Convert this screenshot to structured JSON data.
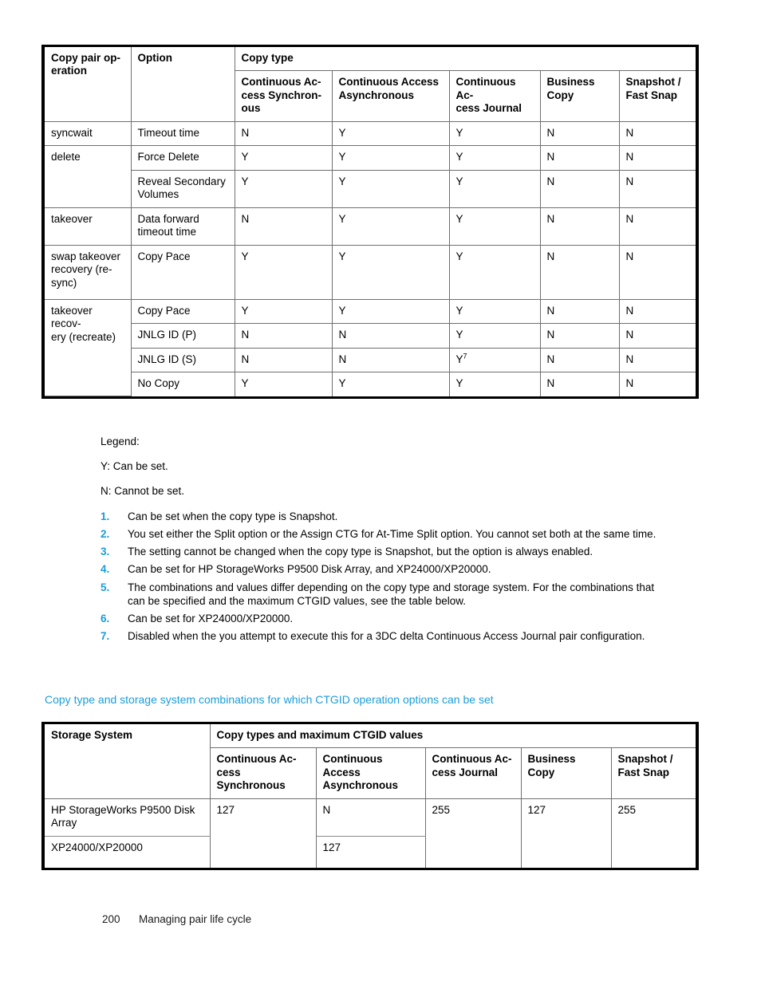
{
  "table1": {
    "group_header": "Copy type",
    "columns": [
      "Copy pair operation",
      "Option",
      "Continuous Access Synchronous",
      "Continuous Access Asynchronous",
      "Continuous Access Journal",
      "Business Copy",
      "Snapshot / Fast Snap"
    ],
    "col_display": {
      "c1": "Copy pair op-\neration",
      "c2": "Option",
      "c3": "Continuous Ac-\ncess Synchron-\nous",
      "c4": "Continuous Access\nAsynchronous",
      "c5": "Continuous Ac-\ncess Journal",
      "c6": "Business\nCopy",
      "c7": "Snapshot /\nFast Snap"
    },
    "rows": [
      {
        "operation": "syncwait",
        "op_rowspan": 1,
        "items": [
          {
            "option": "Timeout time",
            "values": [
              "N",
              "Y",
              "Y",
              "N",
              "N"
            ]
          }
        ]
      },
      {
        "operation": "delete",
        "op_rowspan": 2,
        "items": [
          {
            "option": "Force Delete",
            "values": [
              "Y",
              "Y",
              "Y",
              "N",
              "N"
            ]
          },
          {
            "option": "Reveal Secondary Volumes",
            "values": [
              "Y",
              "Y",
              "Y",
              "N",
              "N"
            ]
          }
        ]
      },
      {
        "operation": "takeover",
        "op_rowspan": 1,
        "items": [
          {
            "option": "Data forward timeout time",
            "values": [
              "N",
              "Y",
              "Y",
              "N",
              "N"
            ]
          }
        ]
      },
      {
        "operation": "swap takeover recovery (re-sync)",
        "op_rowspan": 1,
        "items": [
          {
            "option": "Copy Pace",
            "values": [
              "Y",
              "Y",
              "Y",
              "N",
              "N"
            ]
          }
        ]
      },
      {
        "operation": "takeover recovery (recreate)",
        "op_rowspan": 4,
        "items": [
          {
            "option": "Copy Pace",
            "values": [
              "Y",
              "Y",
              "Y",
              "N",
              "N"
            ]
          },
          {
            "option": "JNLG ID (P)",
            "values": [
              "N",
              "N",
              "Y",
              "N",
              "N"
            ]
          },
          {
            "option": "JNLG ID (S)",
            "values": [
              "N",
              "N",
              "Y",
              "N",
              "N"
            ],
            "footnotes": {
              "2": "7"
            }
          },
          {
            "option": "No Copy",
            "values": [
              "Y",
              "Y",
              "Y",
              "N",
              "N"
            ]
          }
        ]
      }
    ]
  },
  "legend": {
    "title": "Legend:",
    "y_line": "Y: Can be set.",
    "n_line": "N: Cannot be set.",
    "notes": [
      {
        "num": "1.",
        "text": "Can be set when the copy type is Snapshot."
      },
      {
        "num": "2.",
        "text": "You set either the Split option or the Assign CTG for At-Time Split option. You cannot set both at the same time."
      },
      {
        "num": "3.",
        "text": "The setting cannot be changed when the copy type is Snapshot, but the option is always enabled."
      },
      {
        "num": "4.",
        "text": "Can be set for HP StorageWorks P9500 Disk Array, and XP24000/XP20000."
      },
      {
        "num": "5.",
        "text": "The combinations and values differ depending on the copy type and storage system. For the combinations that can be specified and the maximum CTGID values, see the table below."
      },
      {
        "num": "6.",
        "text": "Can be set for XP24000/XP20000."
      },
      {
        "num": "7.",
        "text": "Disabled when the you attempt to execute this for a 3DC delta Continuous Access Journal pair configuration."
      }
    ]
  },
  "caption_link": "Copy type and storage system combinations for which CTGID operation options can be set",
  "table2": {
    "group_header": "Copy types and maximum CTGID values",
    "col1_header": "Storage System",
    "col_display": {
      "c2": "Continuous Ac-\ncess Synchronous",
      "c3": "Continuous Access\nAsynchronous",
      "c4": "Continuous Ac-\ncess Journal",
      "c5": "Business Copy",
      "c6": "Snapshot /\nFast Snap"
    },
    "columns": [
      "Storage System",
      "Continuous Access Synchronous",
      "Continuous Access Asynchronous",
      "Continuous Access Journal",
      "Business Copy",
      "Snapshot / Fast Snap"
    ],
    "systems": [
      "HP StorageWorks P9500 Disk Array",
      "XP24000/XP20000"
    ],
    "values": {
      "ca_sync": "127",
      "ca_async_p9500": "N",
      "ca_async_xp": "127",
      "ca_journal": "255",
      "business_copy": "127",
      "snapshot": "255"
    }
  },
  "footer": {
    "page_number": "200",
    "chapter": "Managing pair life cycle"
  },
  "colors": {
    "link_blue": "#1b9dd9",
    "note_number_blue": "#1b9dd9",
    "rule_gray": "#6f6f6f",
    "frame_black": "#000000"
  }
}
